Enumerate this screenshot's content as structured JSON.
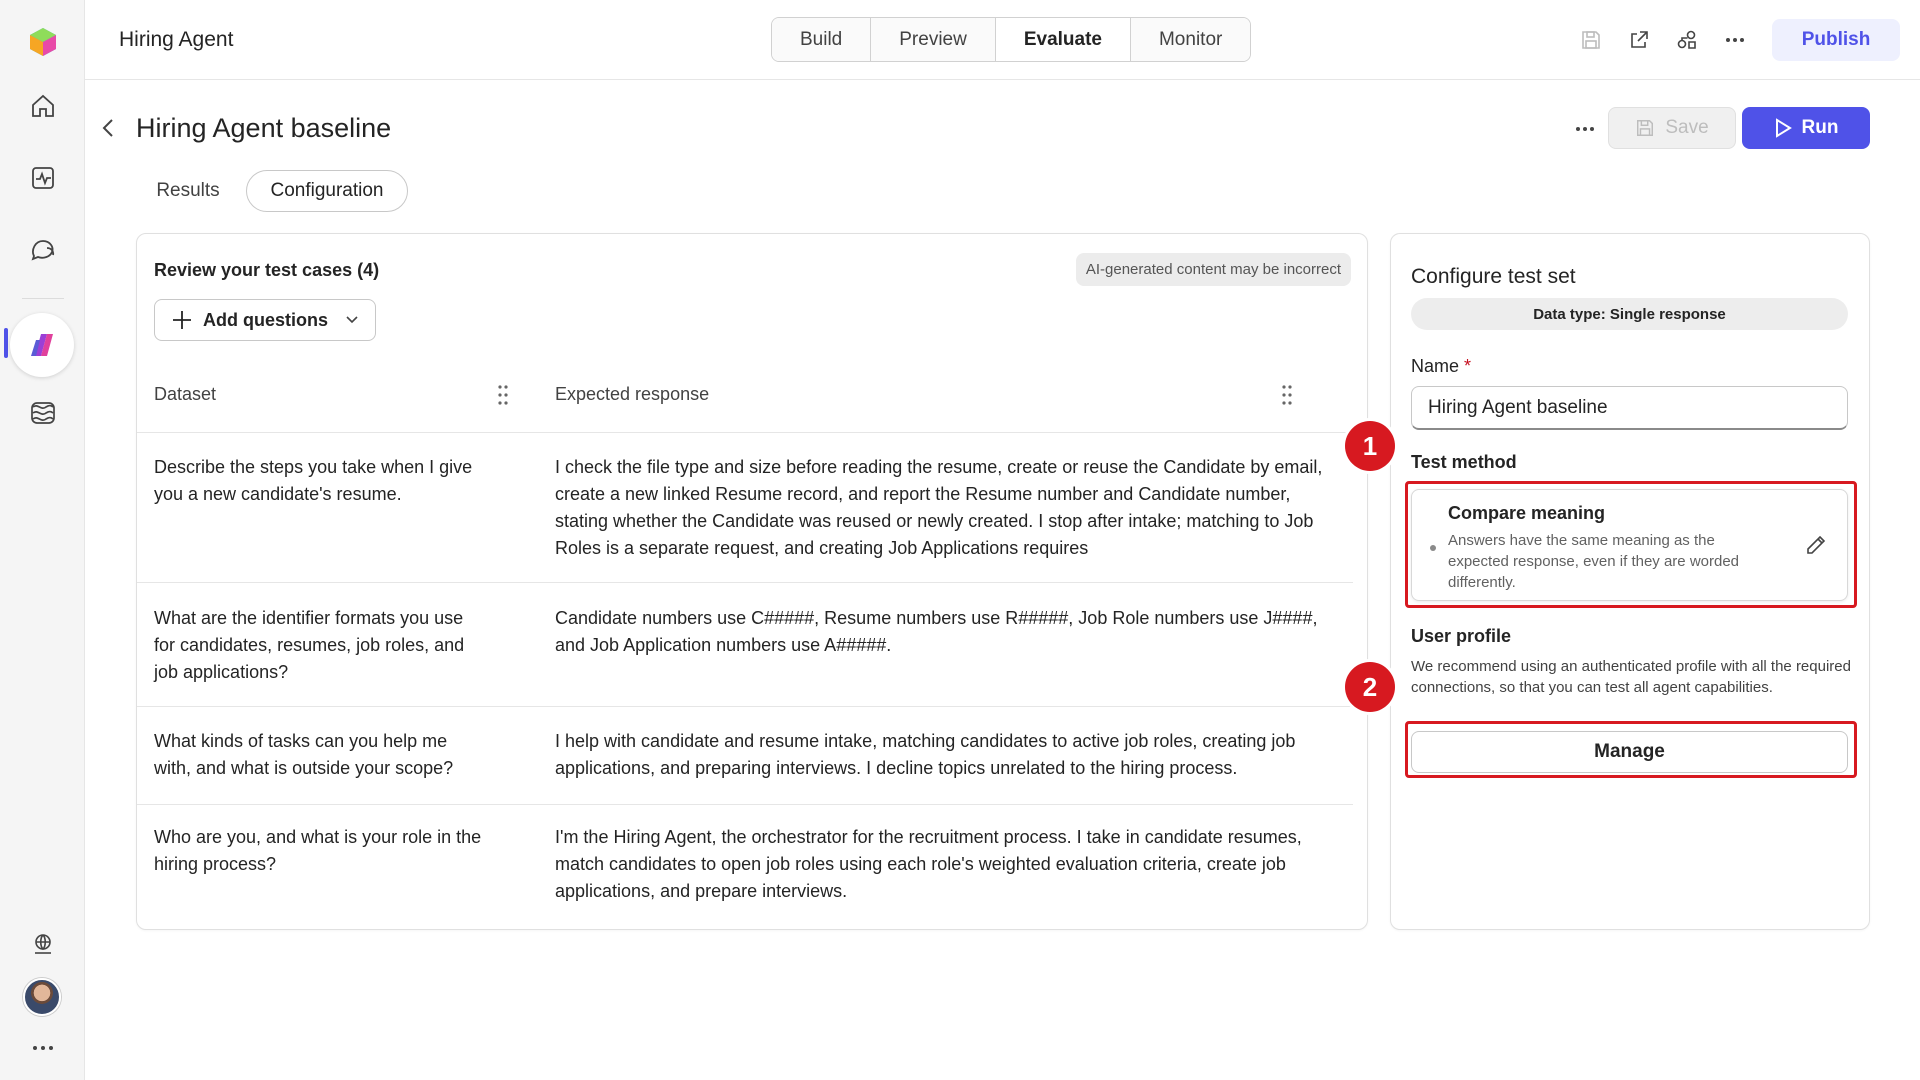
{
  "app": {
    "title": "Hiring Agent"
  },
  "nav": {
    "tabs": [
      {
        "label": "Build"
      },
      {
        "label": "Preview"
      },
      {
        "label": "Evaluate",
        "active": true
      },
      {
        "label": "Monitor"
      }
    ],
    "publish_label": "Publish"
  },
  "rail": {
    "items": [
      "home-icon",
      "activity-icon",
      "chat-icon",
      "agents-icon",
      "data-icon"
    ],
    "bottom": [
      "globe-icon",
      "avatar",
      "more-icon"
    ]
  },
  "page": {
    "title": "Hiring Agent baseline",
    "save_label": "Save",
    "run_label": "Run",
    "tabs": {
      "results": "Results",
      "configuration": "Configuration"
    }
  },
  "test_cases": {
    "heading": "Review your test cases (4)",
    "ai_note": "AI-generated content may be incorrect",
    "add_questions_label": "Add questions",
    "columns": {
      "dataset": "Dataset",
      "expected": "Expected response"
    },
    "rows": [
      {
        "question": "Describe the steps you take when I give you a new candidate's resume.",
        "expected": "I check the file type and size before reading the resume, create or reuse the Candidate by email, create a new linked Resume record, and report the Resume number and Candidate number, stating whether the Candidate was reused or newly created. I stop after intake; matching to Job Roles is a separate request, and creating Job Applications requires"
      },
      {
        "question": "What are the identifier formats you use for candidates, resumes, job roles, and job applications?",
        "expected": "Candidate numbers use C#####, Resume numbers use R#####, Job Role numbers use J####, and Job Application numbers use A#####."
      },
      {
        "question": "What kinds of tasks can you help me with, and what is outside your scope?",
        "expected": "I help with candidate and resume intake, matching candidates to active job roles, creating job applications, and preparing interviews. I decline topics unrelated to the hiring process."
      },
      {
        "question": "Who are you, and what is your role in the hiring process?",
        "expected": "I'm the Hiring Agent, the orchestrator for the recruitment process. I take in candidate resumes, match candidates to open job roles using each role's weighted evaluation criteria, create job applications, and prepare interviews."
      }
    ]
  },
  "config": {
    "title": "Configure test set",
    "data_type": "Data type: Single response",
    "name_label": "Name",
    "required_mark": "*",
    "name_value": "Hiring Agent baseline",
    "test_method_label": "Test method",
    "test_method": {
      "title": "Compare meaning",
      "description": "Answers have the same meaning as the expected response, even if they are worded differently."
    },
    "user_profile_label": "User profile",
    "user_profile_desc": "We recommend using an authenticated profile with all the required connections, so that you can test all agent capabilities.",
    "manage_label": "Manage"
  },
  "annotations": {
    "badge1": "1",
    "badge2": "2",
    "color": "#d71920"
  },
  "colors": {
    "accent": "#4f52e8",
    "publish_bg": "#eef0fe"
  }
}
